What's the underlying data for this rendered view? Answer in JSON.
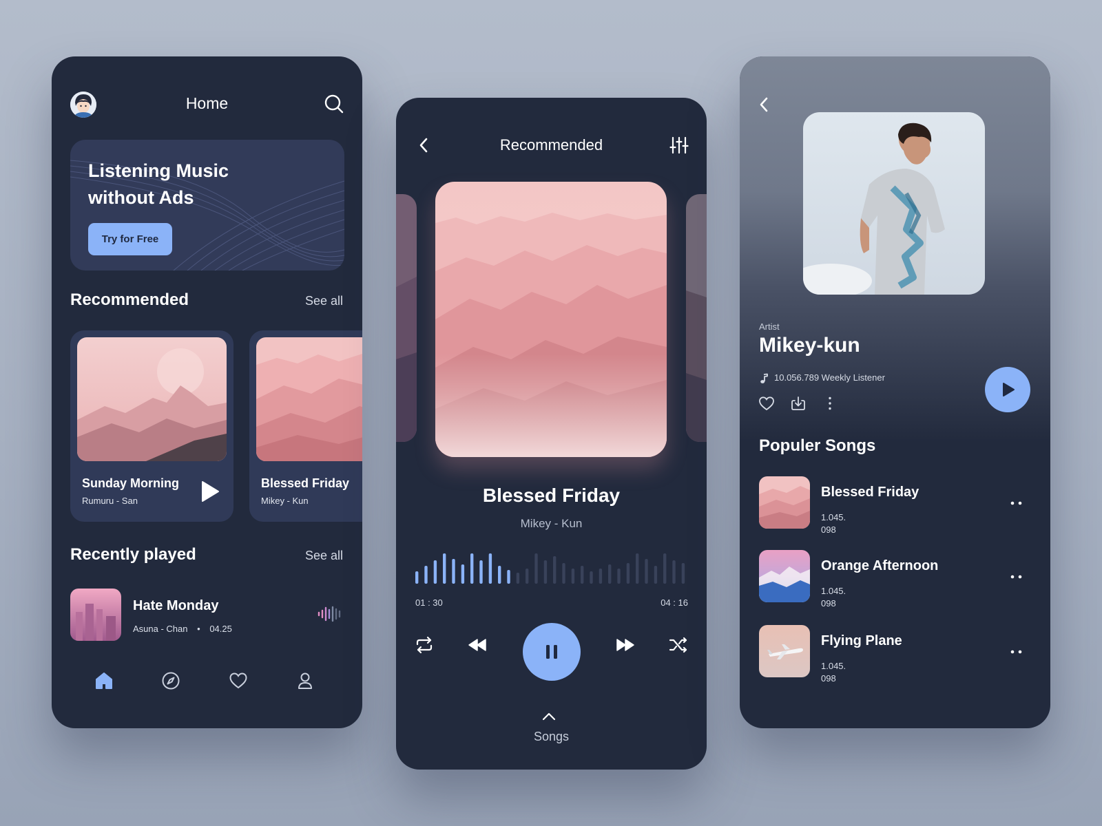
{
  "home": {
    "title": "Home",
    "promo": {
      "line1": "Listening Music",
      "line2": "without Ads",
      "button": "Try for Free"
    },
    "recommended": {
      "title": "Recommended",
      "see_all": "See all",
      "cards": [
        {
          "title": "Sunday Morning",
          "artist": "Rumuru - San"
        },
        {
          "title": "Blessed Friday",
          "artist": "Mikey - Kun"
        }
      ]
    },
    "recent": {
      "title": "Recently played",
      "see_all": "See all",
      "item": {
        "title": "Hate Monday",
        "artist": "Asuna - Chan",
        "separator": "•",
        "duration": "04.25"
      }
    },
    "nav": [
      "home-icon",
      "compass-icon",
      "heart-icon",
      "user-icon"
    ]
  },
  "player": {
    "title": "Recommended",
    "song_title": "Blessed Friday",
    "song_artist": "Mikey - Kun",
    "elapsed": "01 : 30",
    "total": "04 : 16",
    "progress": 0.35,
    "songs_label": "Songs"
  },
  "artist": {
    "label": "Artist",
    "name": "Mikey-kun",
    "listeners": "10.056.789 Weekly  Listener",
    "popular_title": "Populer Songs",
    "songs": [
      {
        "title": "Blessed Friday",
        "count_line1": "1.045.",
        "count_line2": "098"
      },
      {
        "title": "Orange Afternoon",
        "count_line1": "1.045.",
        "count_line2": "098"
      },
      {
        "title": "Flying Plane",
        "count_line1": "1.045.",
        "count_line2": "098"
      }
    ]
  },
  "colors": {
    "accent": "#8bb3f8",
    "card": "#222a3d",
    "panel": "#303a58"
  }
}
